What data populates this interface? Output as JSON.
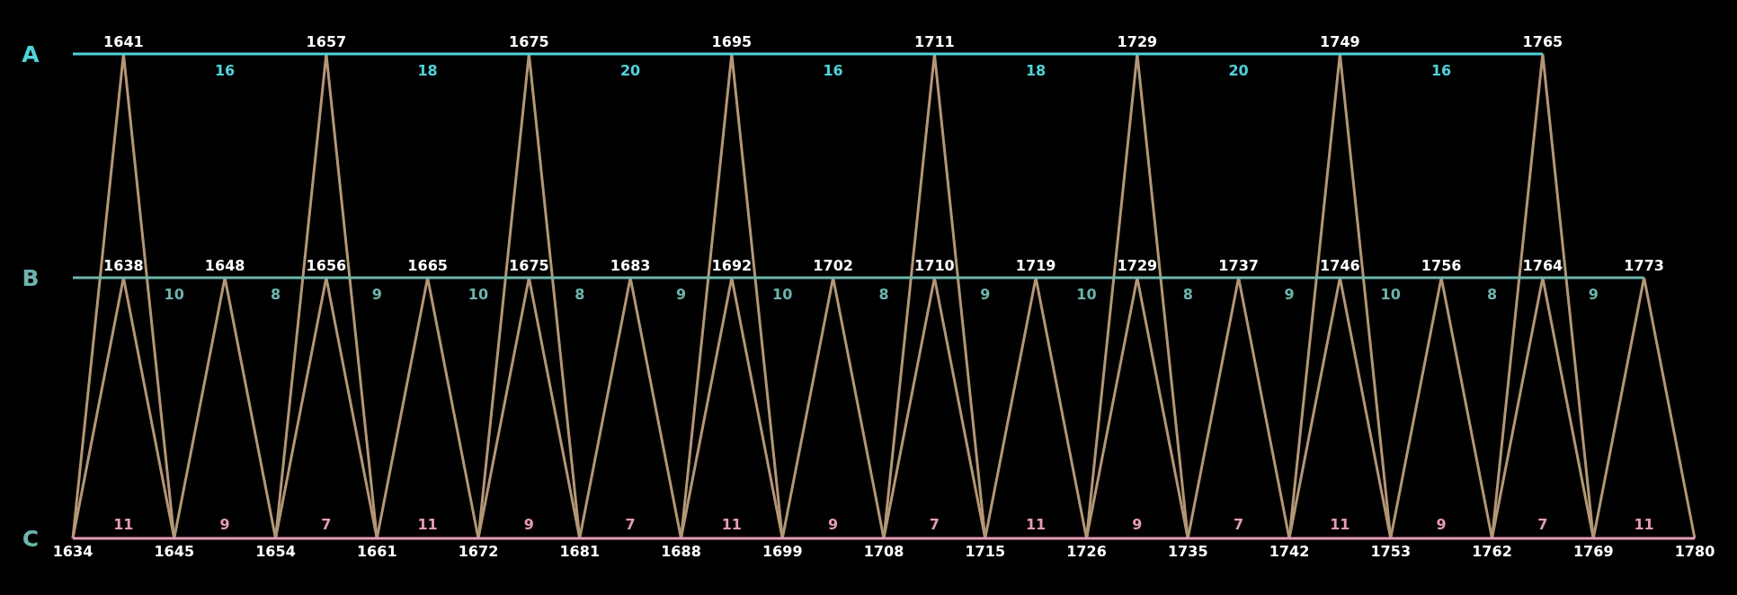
{
  "rows": [
    {
      "label": "A",
      "kind": "upper",
      "color": "#4fd3da",
      "points": [
        "1641",
        "1657",
        "1675",
        "1695",
        "1711",
        "1729",
        "1749",
        "1765"
      ],
      "intervals": [
        "16",
        "18",
        "20",
        "16",
        "18",
        "20",
        "16"
      ]
    },
    {
      "label": "B",
      "kind": "middle",
      "color": "#6cb5ae",
      "points": [
        "1638",
        "1648",
        "1656",
        "1665",
        "1675",
        "1683",
        "1692",
        "1702",
        "1710",
        "1719",
        "1729",
        "1737",
        "1746",
        "1756",
        "1764",
        "1773"
      ],
      "intervals": [
        "10",
        "8",
        "9",
        "10",
        "8",
        "9",
        "10",
        "8",
        "9",
        "10",
        "8",
        "9",
        "10",
        "8",
        "9"
      ]
    },
    {
      "label": "C",
      "kind": "base",
      "color": "#e79ab8",
      "points": [
        "1634",
        "1645",
        "1654",
        "1661",
        "1672",
        "1681",
        "1688",
        "1699",
        "1708",
        "1715",
        "1726",
        "1735",
        "1742",
        "1753",
        "1762",
        "1769",
        "1780"
      ],
      "intervals": [
        "11",
        "9",
        "7",
        "11",
        "9",
        "7",
        "11",
        "9",
        "7",
        "11",
        "9",
        "7",
        "11",
        "9",
        "7",
        "11"
      ]
    }
  ]
}
